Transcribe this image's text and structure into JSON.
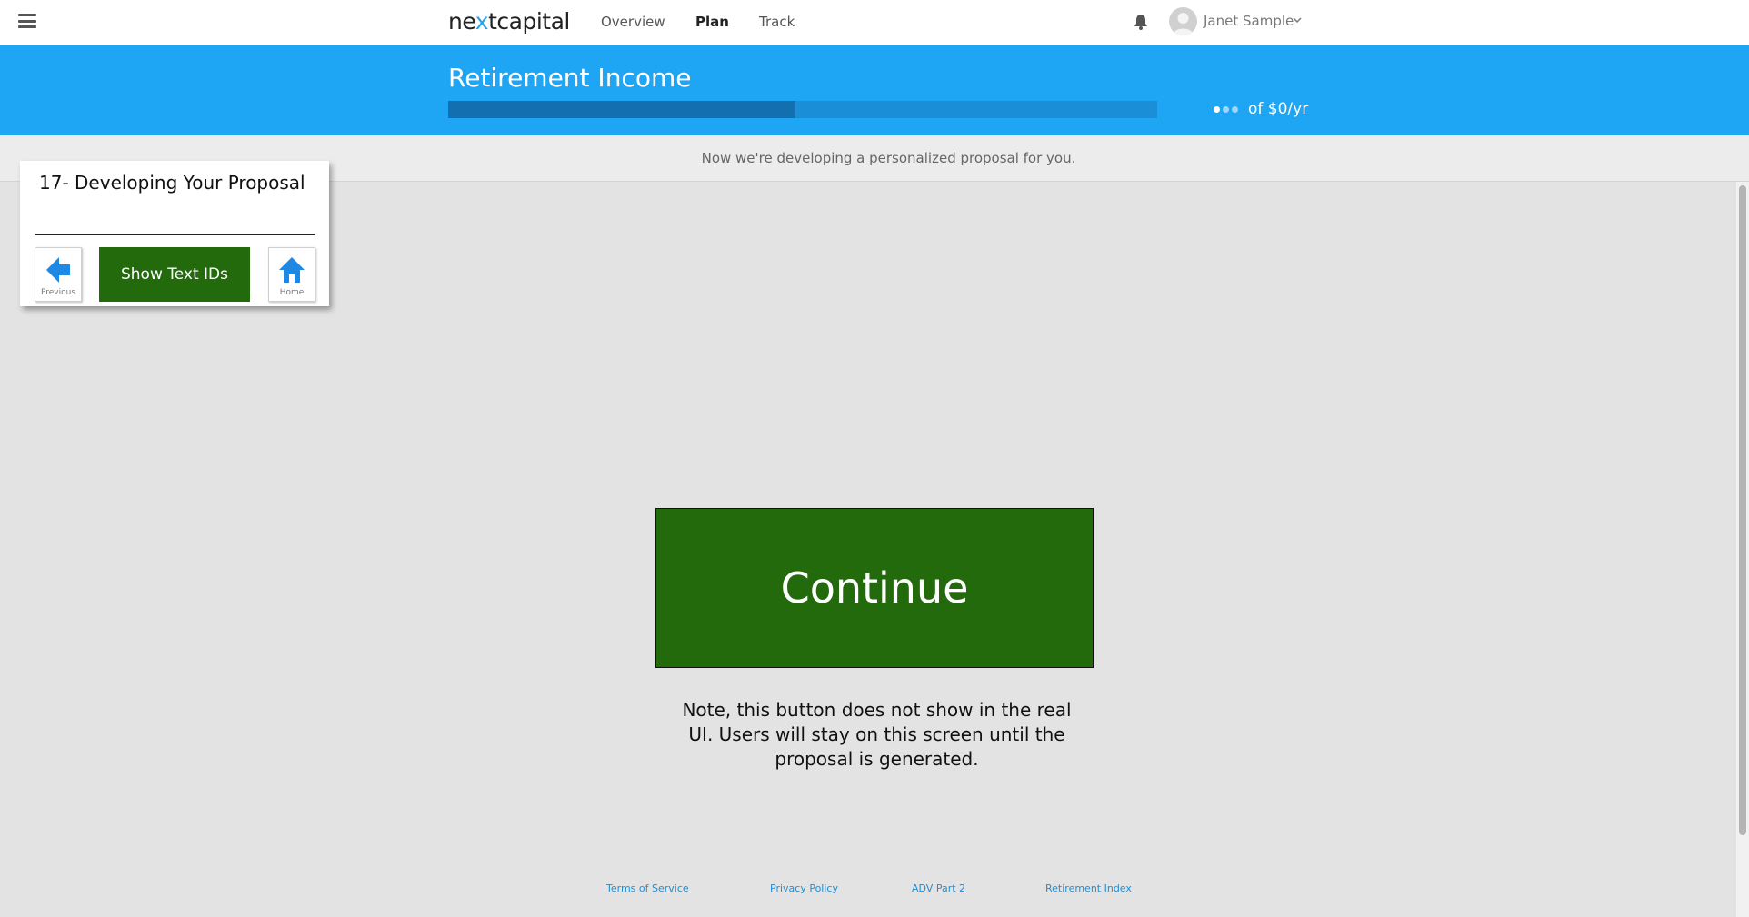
{
  "nav": {
    "logo_pre": "ne",
    "logo_x": "x",
    "logo_post": "tcapital",
    "links": [
      {
        "label": "Overview",
        "active": false
      },
      {
        "label": "Plan",
        "active": true
      },
      {
        "label": "Track",
        "active": false
      }
    ],
    "user_name": "Janet Sample"
  },
  "header": {
    "title": "Retirement Income",
    "progress_fraction": 0.49,
    "income_label": "of $0/yr"
  },
  "message_bar": {
    "text": "Now we're developing a personalized proposal for you."
  },
  "panel": {
    "title": "17- Developing Your Proposal",
    "previous_label": "Previous",
    "show_ids_label": "Show Text IDs",
    "home_label": "Home"
  },
  "main": {
    "continue_label": "Continue",
    "note": "Note, this button does not show in the real UI. Users will stay on this screen until the proposal is generated."
  },
  "footer": {
    "links": [
      "Terms of Service",
      "Privacy Policy",
      "ADV Part 2",
      "Retirement Index"
    ]
  },
  "colors": {
    "accent_blue": "#1ea5f3",
    "progress_fill": "#136fb0",
    "button_green": "#236a0d"
  }
}
